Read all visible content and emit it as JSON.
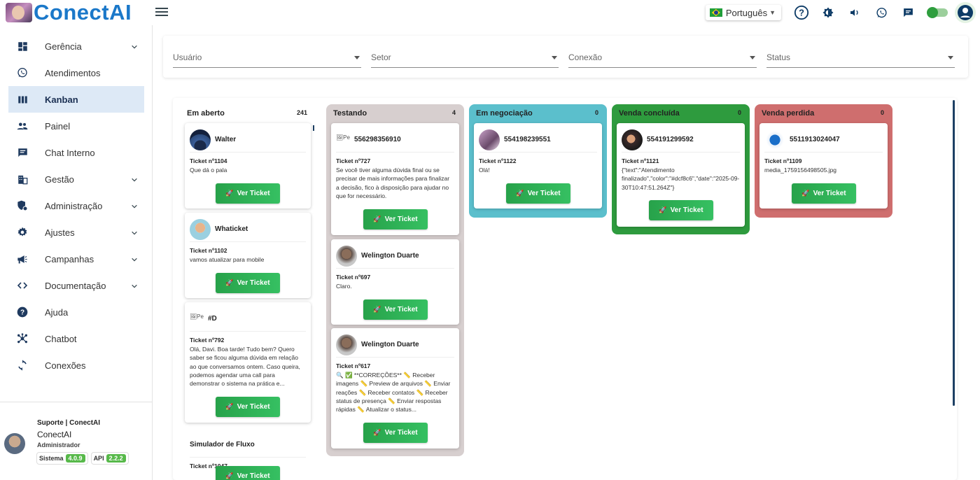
{
  "app": {
    "name": "ConectAI",
    "language": "Português"
  },
  "sidebar": {
    "items": [
      {
        "label": "Gerência",
        "icon": "dashboard-icon",
        "expandable": true
      },
      {
        "label": "Atendimentos",
        "icon": "whatsapp-icon",
        "expandable": false
      },
      {
        "label": "Kanban",
        "icon": "kanban-icon",
        "expandable": false,
        "active": true
      },
      {
        "label": "Painel",
        "icon": "people-icon",
        "expandable": false
      },
      {
        "label": "Chat Interno",
        "icon": "chat-icon",
        "expandable": false
      },
      {
        "label": "Gestão",
        "icon": "building-icon",
        "expandable": true
      },
      {
        "label": "Administração",
        "icon": "admin-icon",
        "expandable": true
      },
      {
        "label": "Ajustes",
        "icon": "gear-icon",
        "expandable": true
      },
      {
        "label": "Campanhas",
        "icon": "megaphone-icon",
        "expandable": true
      },
      {
        "label": "Documentação",
        "icon": "code-icon",
        "expandable": true
      },
      {
        "label": "Ajuda",
        "icon": "help-icon",
        "expandable": false
      },
      {
        "label": "Chatbot",
        "icon": "hub-icon",
        "expandable": false
      },
      {
        "label": "Conexões",
        "icon": "sync-icon",
        "expandable": false
      }
    ],
    "footer": {
      "company": "Suporte | ConectAI",
      "user": "ConectAI",
      "role": "Administrador",
      "system_label": "Sistema",
      "system_version": "4.0.9",
      "api_label": "API",
      "api_version": "2.2.2"
    }
  },
  "filters": {
    "usuario": "Usuário",
    "setor": "Setor",
    "conexao": "Conexão",
    "status": "Status"
  },
  "button_label": "Ver Ticket",
  "lanes": [
    {
      "title": "Em aberto",
      "count": "241",
      "color": "#ffffff",
      "cards": [
        {
          "name": "Walter",
          "ticket": "Ticket nº1104",
          "message": "Que dá o pala"
        },
        {
          "name": "Whaticket",
          "ticket": "Ticket nº1102",
          "message": "vamos atualizar para mobile"
        },
        {
          "name": "#D",
          "ticket": "Ticket nº792",
          "message": "Olá, Davi. Boa tarde! Tudo bem? Quero saber se ficou alguma dúvida em relação ao que conversamos ontem. Caso queira, podemos agendar uma call para demonstrar o sistema na prática e..."
        },
        {
          "name": "Simulador de Fluxo",
          "ticket": "Ticket nº1047",
          "message": ""
        }
      ]
    },
    {
      "title": "Testando",
      "count": "4",
      "color": "#d7cfcf",
      "cards": [
        {
          "name": "556298356910",
          "ticket": "Ticket nº727",
          "message": "Se você tiver alguma dúvida final ou se precisar de mais informações para finalizar a decisão, fico à disposição para ajudar no que for necessário."
        },
        {
          "name": "Welington Duarte",
          "ticket": "Ticket nº697",
          "message": "Claro."
        },
        {
          "name": "Welington Duarte",
          "ticket": "Ticket nº617",
          "message": "🔍 ✅ **CORREÇÕES** 📏 Receber imagens 📏 Preview de arquivos 📏 Enviar reações 📏 Receber contatos 📏 Receber status de presença 📏 Enviar respostas rápidas 📏 Atualizar o status..."
        }
      ]
    },
    {
      "title": "Em negociação",
      "count": "0",
      "color": "#5bbfcc",
      "cards": [
        {
          "name": "554198239551",
          "ticket": "Ticket nº1122",
          "message": "Olá!"
        }
      ]
    },
    {
      "title": "Venda concluída",
      "count": "0",
      "color": "#2e9b3e",
      "cards": [
        {
          "name": "554191299592",
          "ticket": "Ticket nº1121",
          "message": "{\"text\":\"Atendimento finalizado\",\"color\":\"#dcf8c6\",\"date\":\"2025-09-30T10:47:51.264Z\"}"
        }
      ]
    },
    {
      "title": "Venda perdida",
      "count": "0",
      "color": "#cf6e6e",
      "cards": [
        {
          "name": "5511913024047",
          "ticket": "Ticket nº1109",
          "message": "media_1759156498505.jpg"
        }
      ]
    }
  ]
}
